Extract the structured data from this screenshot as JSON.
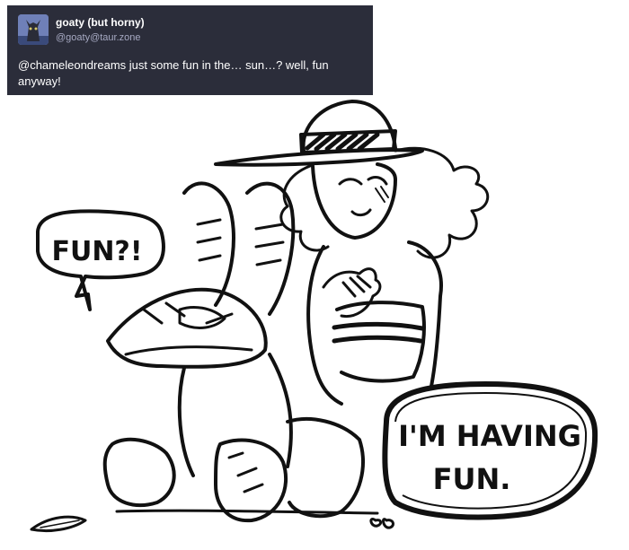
{
  "post": {
    "display_name": "goaty (but horny)",
    "handle": "@goaty@taur.zone",
    "mention": "@chameleondreams",
    "body": " just some fun in the… sun…? well, fun anyway!",
    "avatar_icon": "goat-avatar-icon",
    "card_color": "#2b2d3a",
    "handle_color": "#a6a9c2"
  },
  "drawing": {
    "bubble_left_text": "FUN?!",
    "bubble_right_line1": "I'M HAVING",
    "bubble_right_line2": "FUN."
  }
}
